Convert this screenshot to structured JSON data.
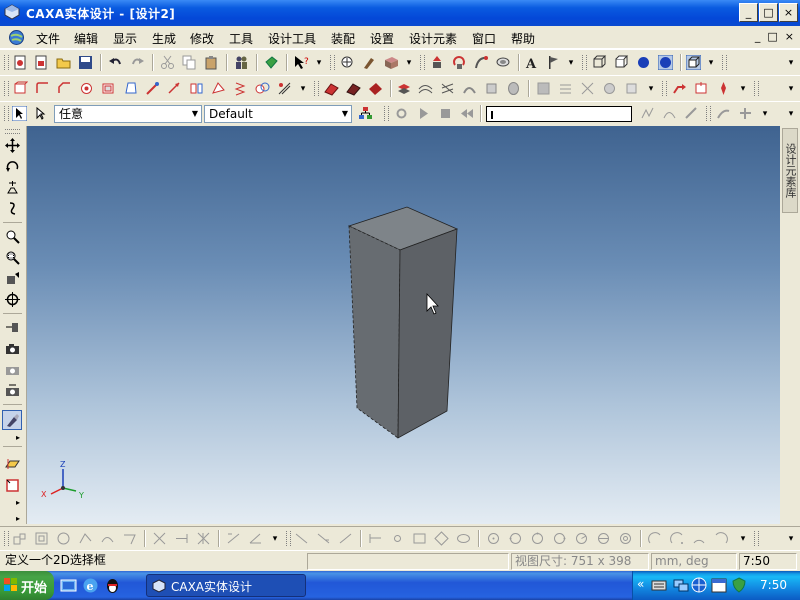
{
  "window": {
    "title": "CAXA实体设计 - [设计2]",
    "buttons": {
      "minimize": "_",
      "restore": "□",
      "close": "×"
    }
  },
  "menubar": {
    "items": [
      "文件",
      "编辑",
      "显示",
      "生成",
      "修改",
      "工具",
      "设计工具",
      "装配",
      "设置",
      "设计元素",
      "窗口",
      "帮助"
    ],
    "mdi": {
      "minimize": "_",
      "restore": "□",
      "close": "×"
    }
  },
  "selection_toolbar": {
    "filter_value": "任意",
    "style_value": "Default"
  },
  "right_panel": {
    "tab_label": "设计元素库"
  },
  "axis_triad": {
    "x": "X",
    "y": "Y",
    "z": "Z"
  },
  "statusbar": {
    "message": "定义一个2D选择框",
    "view_size": "视图尺寸: 751 x 398",
    "units": "mm, deg",
    "time": "7:50"
  },
  "taskbar": {
    "start_label": "开始",
    "task_label": "CAXA实体设计",
    "tray_chevron": "«",
    "clock": "7:50"
  },
  "colors": {
    "title_bar": "#0a5be0",
    "viewport_top": "#3f6390",
    "viewport_bottom": "#e4ecf3",
    "solid_face": "#6b7075",
    "taskbar": "#2157d7"
  }
}
